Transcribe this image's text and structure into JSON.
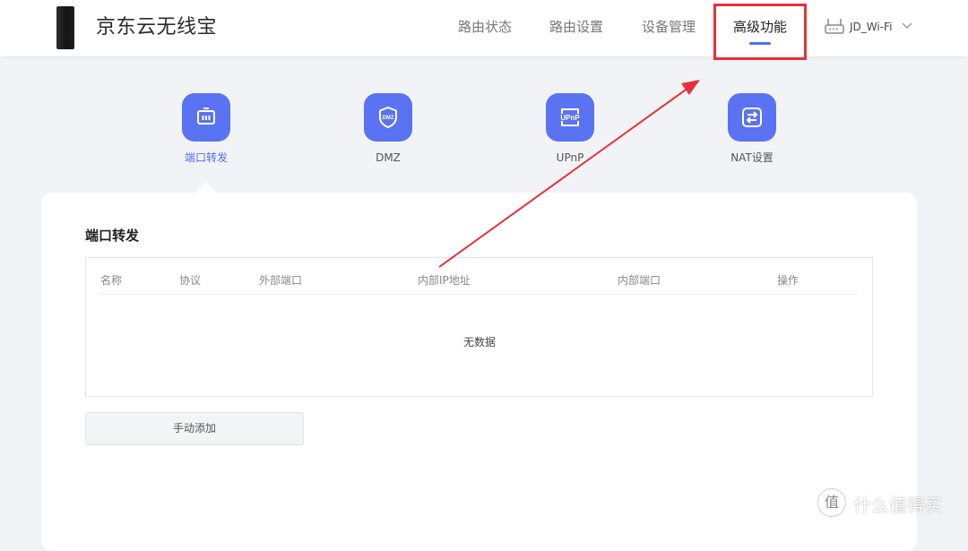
{
  "header": {
    "brand": "京东云无线宝",
    "nav": [
      "路由状态",
      "路由设置",
      "设备管理",
      "高级功能"
    ],
    "active_nav": "高级功能",
    "wifi_name": "JD_Wi-Fi"
  },
  "features": [
    {
      "label": "端口转发",
      "icon": "port-forward-icon",
      "active": true
    },
    {
      "label": "DMZ",
      "icon": "dmz-shield-icon",
      "active": false
    },
    {
      "label": "UPnP",
      "icon": "upnp-icon",
      "active": false
    },
    {
      "label": "NAT设置",
      "icon": "nat-icon",
      "active": false
    }
  ],
  "section": {
    "title": "端口转发",
    "columns": [
      "名称",
      "协议",
      "外部端口",
      "内部IP地址",
      "内部端口",
      "操作"
    ],
    "empty_text": "无数据",
    "add_button": "手动添加"
  },
  "icons": {
    "dmz_badge": "DMZ",
    "upnp_badge": "UPnP"
  },
  "colors": {
    "accent": "#4f6ef5",
    "tile": "#5a73f3",
    "annotation": "#e8303a"
  },
  "watermark": {
    "glyph": "值",
    "text": "什么值得买"
  }
}
